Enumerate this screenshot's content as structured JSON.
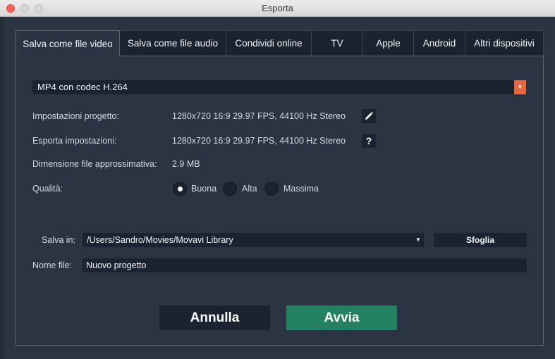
{
  "window": {
    "title": "Esporta"
  },
  "tabs": [
    {
      "label": "Salva come file video",
      "active": true
    },
    {
      "label": "Salva come file audio",
      "active": false
    },
    {
      "label": "Condividi online",
      "active": false
    },
    {
      "label": "TV",
      "active": false
    },
    {
      "label": "Apple",
      "active": false
    },
    {
      "label": "Android",
      "active": false
    },
    {
      "label": "Altri dispositivi",
      "active": false
    }
  ],
  "format": {
    "selected": "MP4 con codec H.264"
  },
  "project_settings": {
    "label": "Impostazioni progetto:",
    "value": "1280x720 16:9 29.97 FPS, 44100 Hz Stereo",
    "icon": "pencil-icon"
  },
  "export_settings": {
    "label": "Esporta impostazioni:",
    "value": "1280x720 16:9 29.97 FPS, 44100 Hz Stereo",
    "icon": "question-icon"
  },
  "file_size": {
    "label": "Dimensione file approssimativa:",
    "value": "2.9 MB"
  },
  "quality": {
    "label": "Qualità:",
    "options": [
      {
        "label": "Buona",
        "checked": true
      },
      {
        "label": "Alta",
        "checked": false
      },
      {
        "label": "Massima",
        "checked": false
      }
    ]
  },
  "save_in": {
    "label": "Salva in:",
    "value": "/Users/Sandro/Movies/Movavi Library",
    "browse_label": "Sfoglia"
  },
  "file_name": {
    "label": "Nome file:",
    "value": "Nuovo progetto"
  },
  "actions": {
    "cancel_label": "Annulla",
    "start_label": "Avvia"
  },
  "colors": {
    "accent_orange": "#e7683f",
    "start_green": "#23825f",
    "background": "#2b3442",
    "field": "#1c2330"
  }
}
